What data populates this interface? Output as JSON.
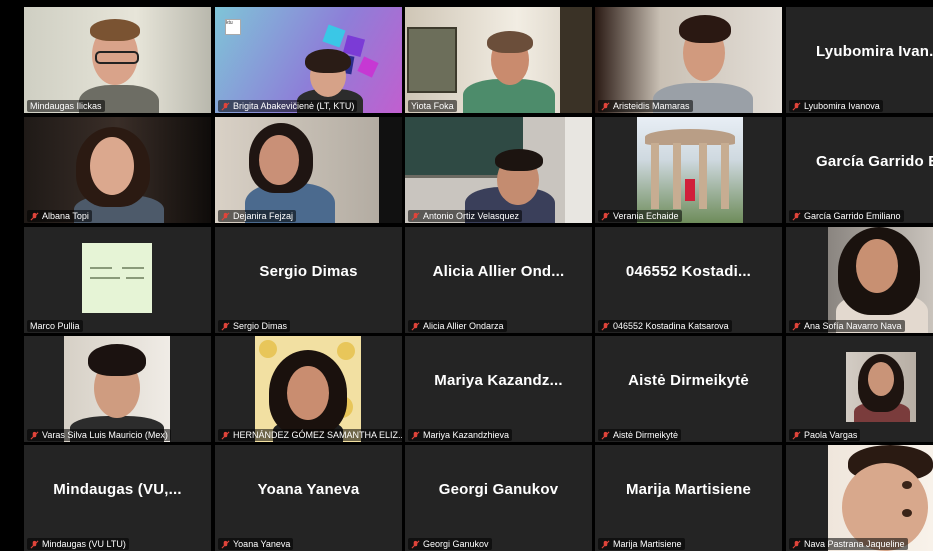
{
  "participants": [
    {
      "name": "Mindaugas Ilickas",
      "muted": false
    },
    {
      "name": "Brigita Abakevičienė (LT, KTU)",
      "muted": true
    },
    {
      "name": "Yiota Foka",
      "muted": false
    },
    {
      "name": "Aristeidis Mamaras",
      "muted": true
    },
    {
      "name": "Lyubomira Ivanova",
      "muted": true,
      "display": "Lyubomira Ivan..."
    },
    {
      "name": "Albana Topi",
      "muted": true
    },
    {
      "name": "Dejanira Fejzaj",
      "muted": true
    },
    {
      "name": "Antonio Ortiz Velasquez",
      "muted": true
    },
    {
      "name": "Verania Echaide",
      "muted": true
    },
    {
      "name": "García Garrido Emiliano",
      "muted": true,
      "display": "García Garrido E"
    },
    {
      "name": "Marco Pullia",
      "muted": false
    },
    {
      "name": "Sergio Dimas",
      "muted": true,
      "display": "Sergio Dimas"
    },
    {
      "name": "Alicia Allier Ondarza",
      "muted": true,
      "display": "Alicia Allier Ond..."
    },
    {
      "name": "046552 Kostadina Katsarova",
      "muted": true,
      "display": "046552 Kostadi..."
    },
    {
      "name": "Ana Sofía Navarro Nava",
      "muted": true
    },
    {
      "name": "Varas Silva Luis Mauricio (Mex)",
      "muted": true
    },
    {
      "name": "HERNÁNDEZ GÓMEZ SAMANTHA ELIZ...",
      "muted": true
    },
    {
      "name": "Mariya Kazandzhieva",
      "muted": true,
      "display": "Mariya Kazandz..."
    },
    {
      "name": "Aistė Dirmeikytė",
      "muted": true,
      "display": "Aistė Dirmeikytė"
    },
    {
      "name": "Paola Vargas",
      "muted": true
    },
    {
      "name": "Mindaugas (VU LTU)",
      "muted": true,
      "display": "Mindaugas (VU,..."
    },
    {
      "name": "Yoana Yaneva",
      "muted": true,
      "display": "Yoana Yaneva"
    },
    {
      "name": "Georgi Ganukov",
      "muted": true,
      "display": "Georgi Ganukov"
    },
    {
      "name": "Marija Martisiene",
      "muted": true,
      "display": "Marija Martisiene"
    },
    {
      "name": "Nava Pastrana Jaqueline",
      "muted": true
    }
  ],
  "colors": {
    "active_speaker": "#c7d34a",
    "muted_icon": "#e0443a",
    "tile_bg": "#242424"
  },
  "icons": {
    "muted": "mic-muted-icon"
  }
}
